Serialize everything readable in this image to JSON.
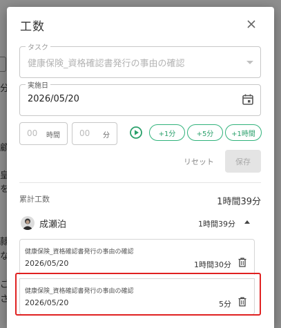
{
  "background": {
    "fragments": [
      "分",
      "顧",
      "皇",
      "を",
      "隷",
      "な",
      "ご",
      "さ"
    ]
  },
  "dialog": {
    "title": "工数",
    "task": {
      "label": "タスク",
      "value": "健康保険_資格確認書発行の事由の確認"
    },
    "date": {
      "label": "実施日",
      "value": "2026/05/20"
    },
    "duration": {
      "hours_placeholder": "00",
      "hours_unit": "時間",
      "minutes_placeholder": "00",
      "minutes_unit": "分"
    },
    "quick_add": [
      "+1分",
      "+5分",
      "+1時間"
    ],
    "reset_label": "リセット",
    "save_label": "保存",
    "summary": {
      "label": "累計工数",
      "total": "1時間39分"
    },
    "user": {
      "name": "成瀬泊",
      "total": "1時間39分"
    },
    "entries": [
      {
        "task": "健康保険_資格確認書発行の事由の確認",
        "date": "2026/05/20",
        "duration": "1時間30分"
      },
      {
        "task": "健康保険_資格確認書発行の事由の確認",
        "date": "2026/05/20",
        "duration": "5分"
      }
    ]
  },
  "colors": {
    "accent_green": "#2aa06b",
    "highlight_red": "#e02020"
  }
}
